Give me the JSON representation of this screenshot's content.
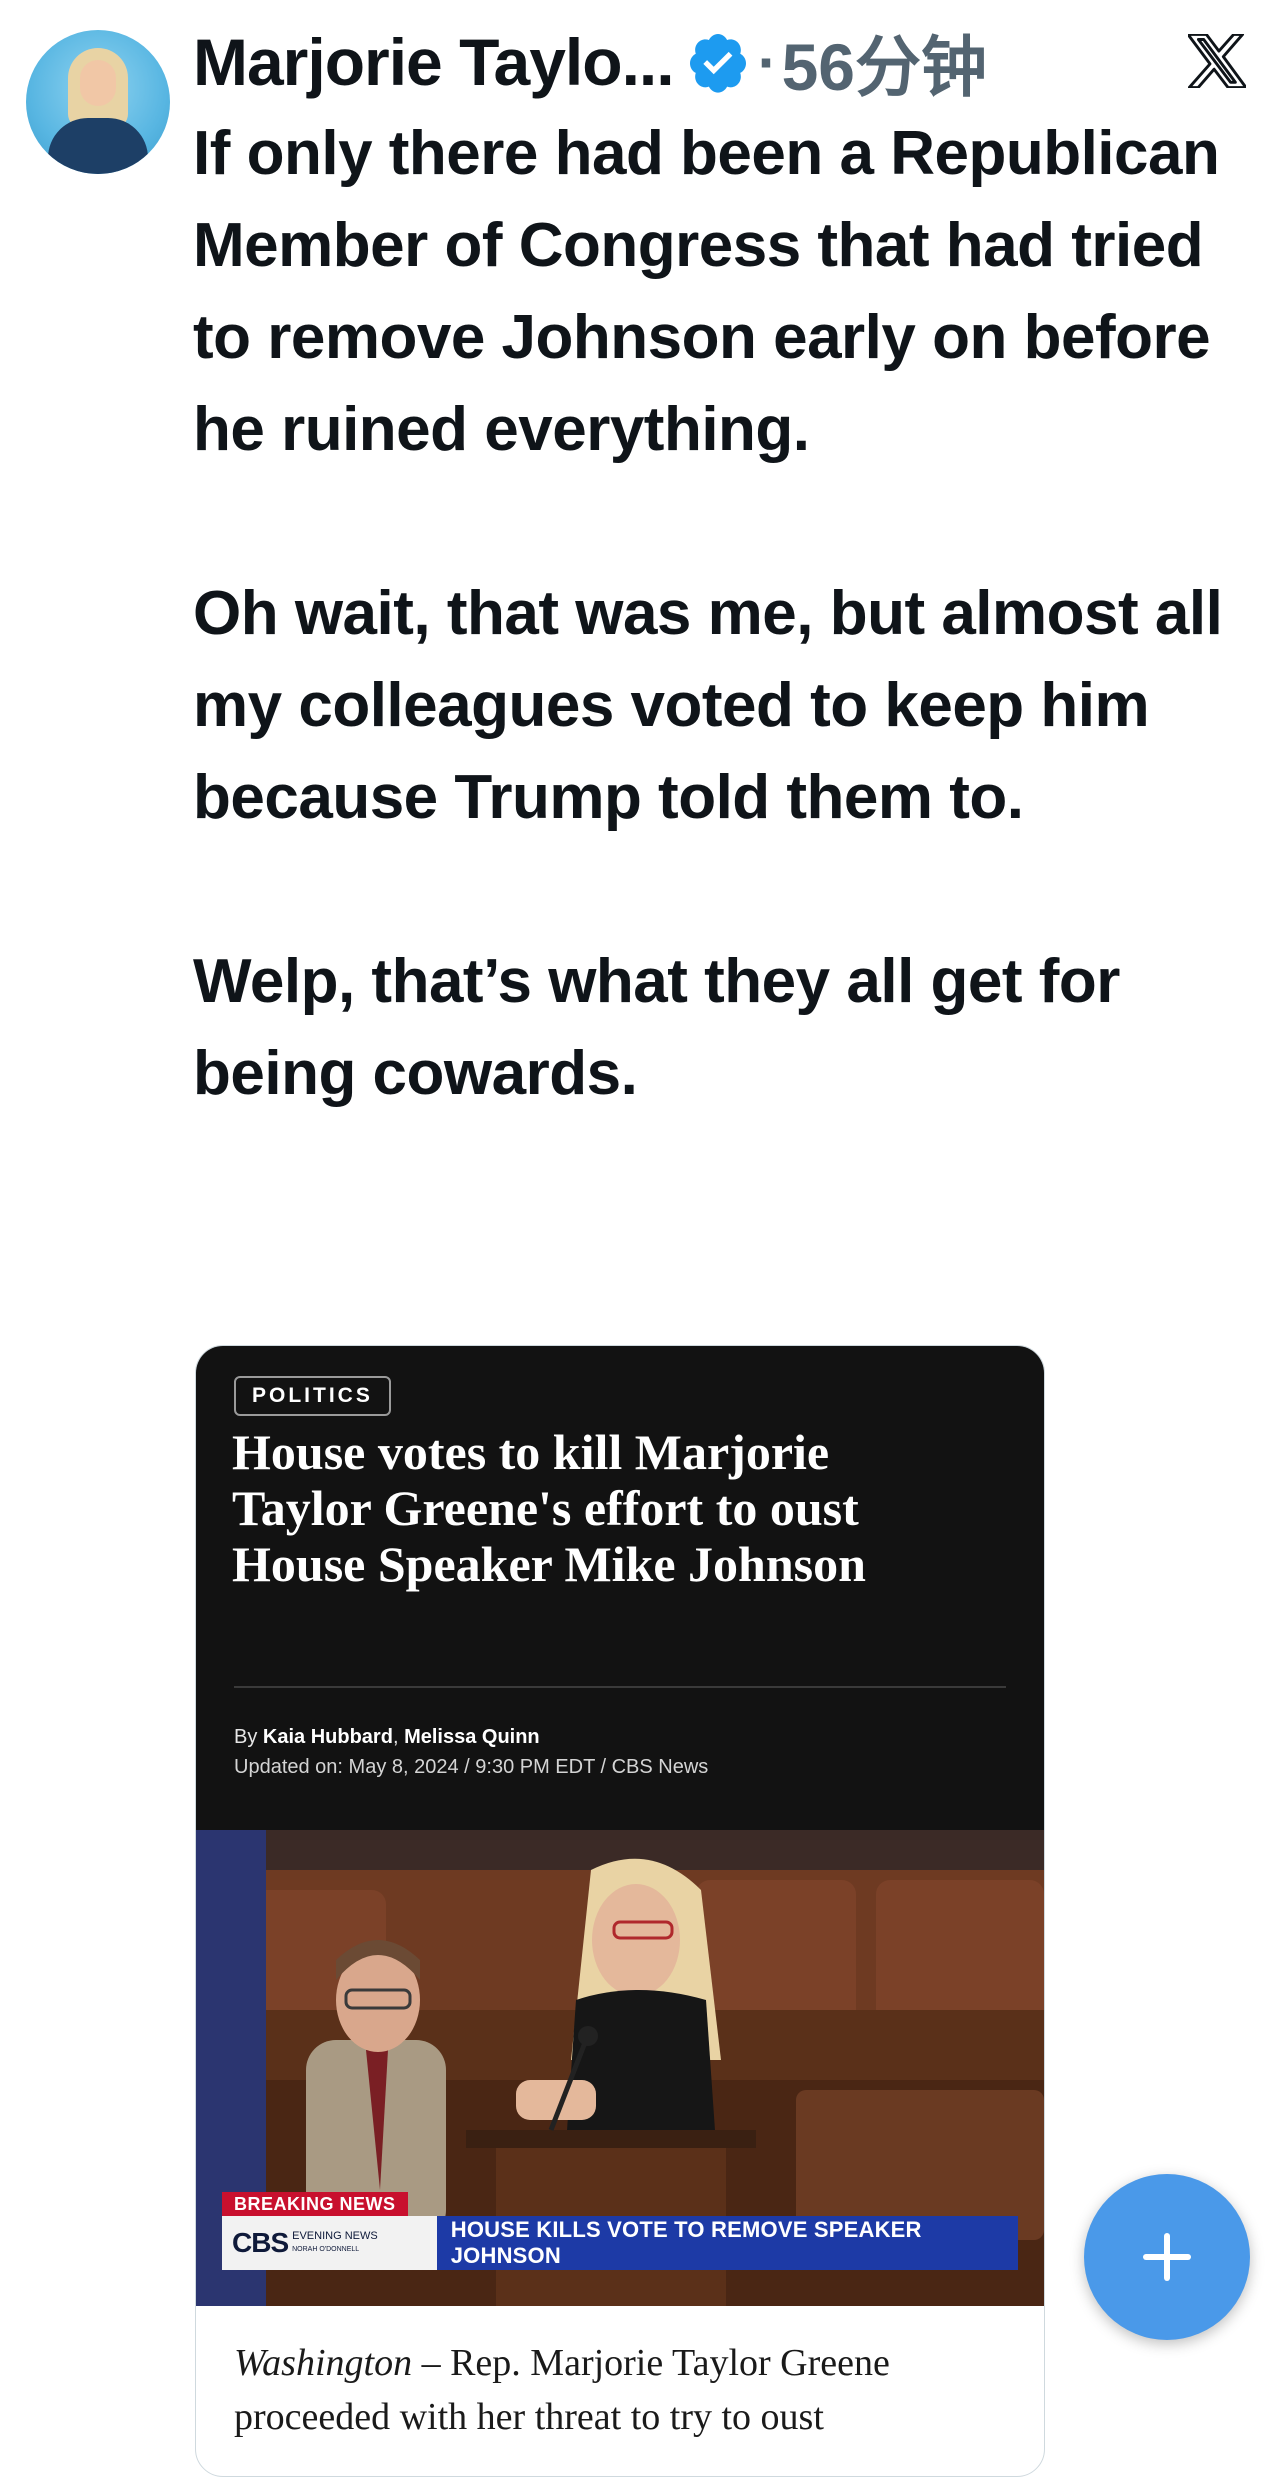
{
  "header": {
    "author_name": "Marjorie Taylo...",
    "separator": "·",
    "time_ago": "56分钟"
  },
  "tweet": {
    "text": "If only there had been a Republican Member of Congress that had tried to remove Johnson early on before he ruined everything.\n\nOh wait, that was me, but almost all my colleagues voted to keep him because Trump told them to.\n\nWelp, that’s what they all get for being cowards."
  },
  "card": {
    "category": "POLITICS",
    "headline": "House votes to kill Marjorie Taylor Greene's effort to oust House Speaker Mike Johnson",
    "byline_prefix": "By ",
    "author1": "Kaia Hubbard",
    "byline_sep": ", ",
    "author2": "Melissa Quinn",
    "updated": "Updated on: May 8, 2024 / 9:30 PM EDT / CBS News",
    "breaking": "BREAKING NEWS",
    "cbs_logo": "CBS",
    "cbs_sub": "EVENING NEWS",
    "cbs_sub2": "NORAH O'DONNELL",
    "chyron": "HOUSE KILLS VOTE TO REMOVE SPEAKER JOHNSON",
    "dateline": "Washington",
    "body": " – Rep. Marjorie Taylor Greene proceeded with her threat to try to oust"
  },
  "colors": {
    "verified": "#1d9bf0",
    "fab": "#4a99e9",
    "muted_text": "#536471"
  },
  "icons": {
    "verified": "verified-badge-icon",
    "close": "x-logo-icon",
    "compose": "plus-icon"
  }
}
